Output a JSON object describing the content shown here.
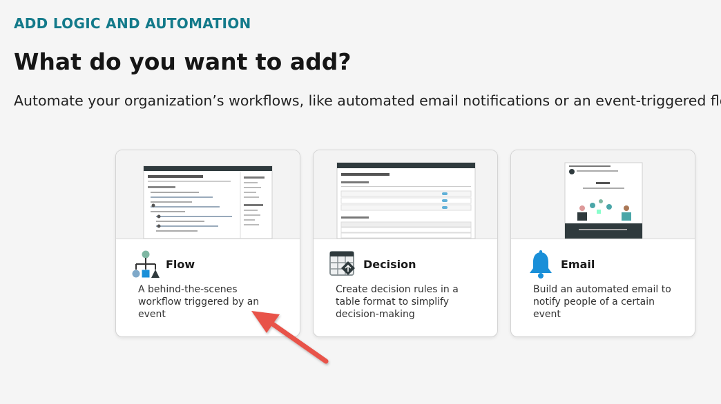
{
  "header": {
    "kicker": "ADD LOGIC AND AUTOMATION",
    "title": "What do you want to add?",
    "subtitle": "Automate your organization’s workflows, like automated email notifications or an event-triggered flow, to impr"
  },
  "cards": [
    {
      "name": "Flow",
      "description": "A behind-the-scenes workflow triggered by an event",
      "icon": "flow-diagram-icon",
      "preview": "flow-designer-screenshot"
    },
    {
      "name": "Decision",
      "description": "Create decision rules in a table format to simplify decision-making",
      "icon": "decision-table-icon",
      "preview": "decision-table-screenshot"
    },
    {
      "name": "Email",
      "description": "Build an automated email to notify people of a certain event",
      "icon": "bell-icon",
      "preview": "email-notification-screenshot"
    }
  ],
  "annotation": {
    "icon": "red-arrow-icon",
    "color": "#e8534a"
  },
  "colors": {
    "accent": "#137a8a",
    "background": "#f5f5f5",
    "icon_blue": "#1a8fd8",
    "icon_teal": "#4aa6a8"
  }
}
